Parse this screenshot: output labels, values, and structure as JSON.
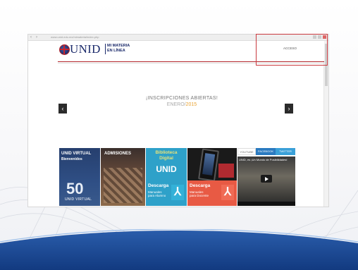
{
  "browser": {
    "url": "www.unid.edu.mx/mimateria/index.php",
    "nav": {
      "back": "‹",
      "forward": "›"
    }
  },
  "header": {
    "logo_text": "UNID",
    "logo_sub_line1": "MI MATERIA",
    "logo_sub_line2": "EN LÍNEA",
    "access_label": "ACCESO"
  },
  "banner": {
    "headline": "¡INSCRIPCIONES ABIERTAS!",
    "month": "ENERO/",
    "year": "2015",
    "prev_arrow": "‹",
    "next_arrow": "›"
  },
  "tiles": {
    "unid_virtual": {
      "title": "UNID VIRTUAL",
      "subtitle": "Bienvenidos",
      "number": "50",
      "caption": "UNID VIRTUAL"
    },
    "admisiones": {
      "title": "ADMISIONES"
    },
    "biblioteca": {
      "line1": "Biblioteca",
      "line2": "Digital",
      "line3": "UNID"
    },
    "descarga_alumno": {
      "title": "Descarga",
      "line1": "Manuales",
      "line2": "para Alumno"
    },
    "descarga_docente": {
      "title": "Descarga",
      "line1": "Manuales",
      "line2": "para Docente"
    }
  },
  "social": {
    "tabs": [
      "YOUTUBE",
      "FACEBOOK",
      "TWITTER"
    ],
    "video_title": "UNID, es ¡Un Mundo de Posibilidades!"
  },
  "colors": {
    "brand_navy": "#1c2b6b",
    "brand_red": "#b3262d",
    "bib_blue": "#2ea1c9",
    "docente_orange": "#e85a44"
  }
}
